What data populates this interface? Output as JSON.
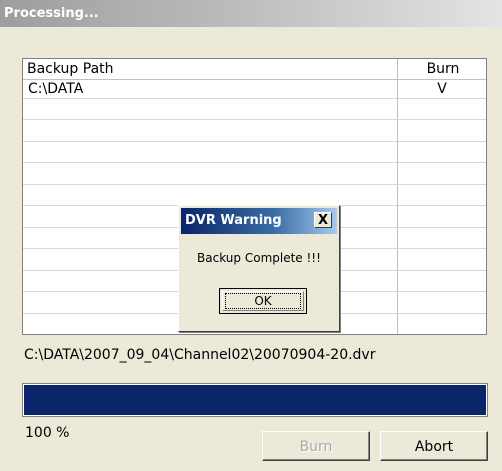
{
  "window": {
    "title": "Processing..."
  },
  "table": {
    "columns": [
      "Backup Path",
      "Burn"
    ],
    "rows": [
      {
        "path": "C:\\DATA",
        "burn": "V"
      }
    ]
  },
  "dialog": {
    "title": "DVR Warning",
    "close_label": "X",
    "message": "Backup Complete !!!",
    "ok_label": "OK"
  },
  "status": {
    "file_path": "C:\\DATA\\2007_09_04\\Channel02\\20070904-20.dvr",
    "progress_percent": 100,
    "percent_label": "100  %"
  },
  "buttons": {
    "burn_label": "Burn",
    "abort_label": "Abort"
  },
  "colors": {
    "progress_fill": "#0a246a",
    "dialog_title_start": "#0a246a",
    "face": "#ece9d8"
  }
}
